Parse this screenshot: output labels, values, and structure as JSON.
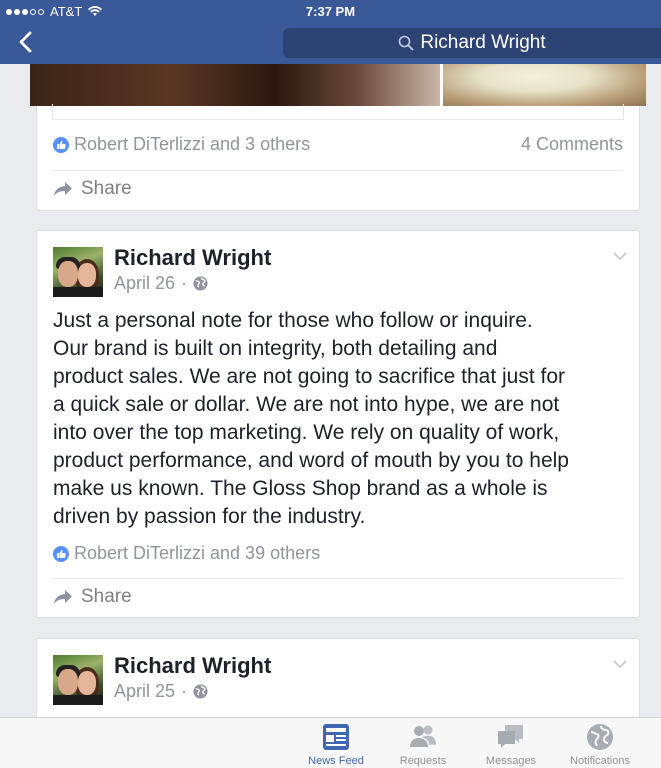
{
  "status_bar": {
    "carrier": "AT&T",
    "time": "7:37 PM"
  },
  "nav": {
    "search_text": "Richard Wright"
  },
  "colors": {
    "facebook_blue": "#3b5998",
    "like_blue": "#5890ff",
    "active_tab": "#4267b2"
  },
  "post_prev": {
    "likes_text": "Robert DiTerlizzi and 3 others",
    "comments_text": "4 Comments",
    "share_label": "Share"
  },
  "post_main": {
    "author": "Richard Wright",
    "date": "April 26",
    "separator": "·",
    "body": "Just a personal note for those who follow or inquire.\nOur brand is built on integrity, both detailing and\nproduct sales.  We are not going to sacrifice that just for\na quick sale or dollar.  We are not into hype, we are not\ninto over the top marketing.  We rely on quality of work,\nproduct performance, and word of mouth by you to help\nmake us known.  The Gloss Shop brand as a whole is\ndriven by passion for the industry.",
    "likes_text": "Robert DiTerlizzi and 39 others",
    "share_label": "Share"
  },
  "post_next": {
    "author": "Richard Wright",
    "date": "April 25",
    "separator": "·"
  },
  "tabbar": {
    "tabs": [
      {
        "label": "News Feed",
        "icon": "news-feed-icon",
        "active": true
      },
      {
        "label": "Requests",
        "icon": "requests-icon",
        "active": false
      },
      {
        "label": "Messages",
        "icon": "messages-icon",
        "active": false
      },
      {
        "label": "Notifications",
        "icon": "notifications-icon",
        "active": false
      }
    ]
  }
}
